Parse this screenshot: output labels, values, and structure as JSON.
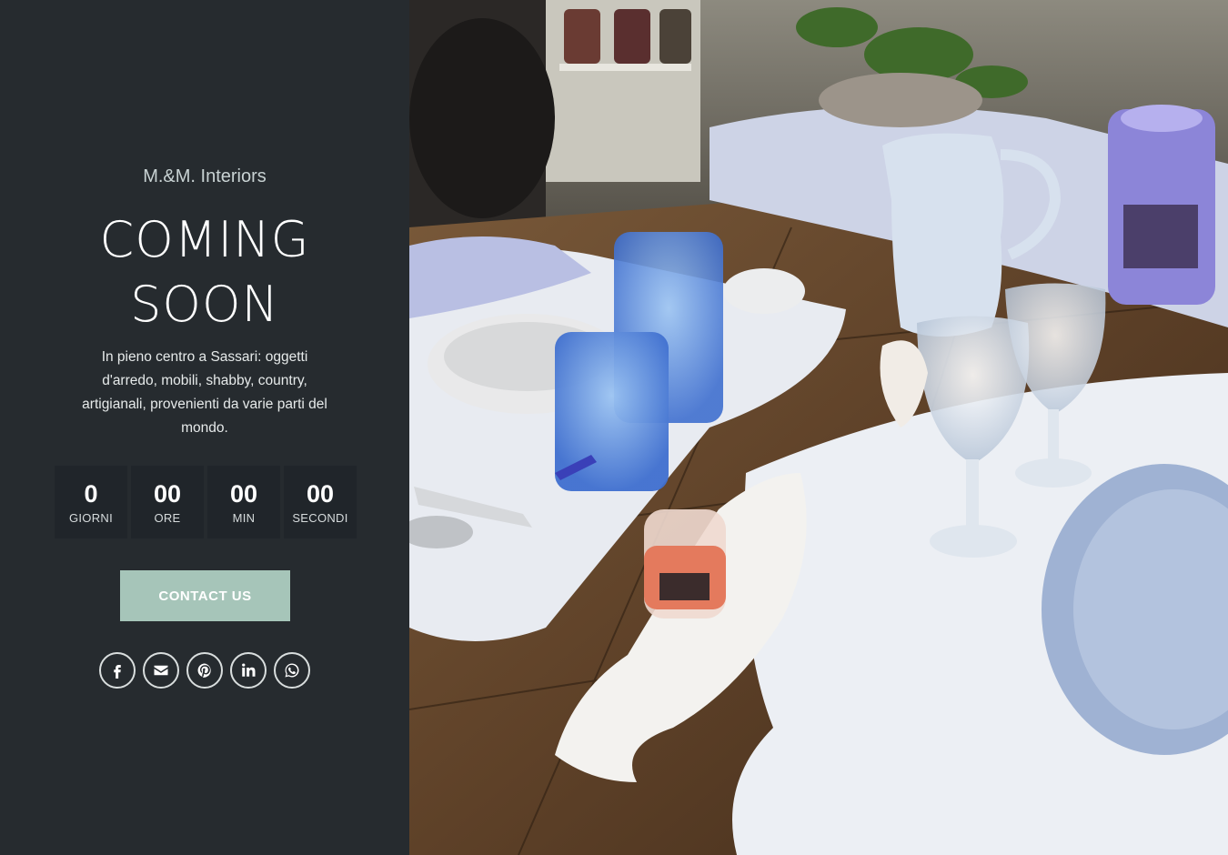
{
  "brand": {
    "name": "M.&M. Interiors"
  },
  "headline": {
    "line1": "COMING",
    "line2": "SOON"
  },
  "tagline": "In pieno centro a Sassari: oggetti d'arredo, mobili, shabby, country, artigianali, provenienti da varie parti del mondo.",
  "countdown": [
    {
      "value": "0",
      "label": "GIORNI"
    },
    {
      "value": "00",
      "label": "ORE"
    },
    {
      "value": "00",
      "label": "MIN"
    },
    {
      "value": "00",
      "label": "SECONDI"
    }
  ],
  "cta": {
    "label": "CONTACT US"
  },
  "socials": [
    {
      "icon": "facebook-icon"
    },
    {
      "icon": "envelope-icon"
    },
    {
      "icon": "pinterest-icon"
    },
    {
      "icon": "linkedin-icon"
    },
    {
      "icon": "whatsapp-icon"
    }
  ],
  "colors": {
    "panel_bg": "#262b2f",
    "countdown_bg": "#20252a",
    "button_bg": "#a6c5b9",
    "brand_text": "#c8d2d3"
  },
  "hero": {
    "description_icon": "photo-table-setting"
  }
}
